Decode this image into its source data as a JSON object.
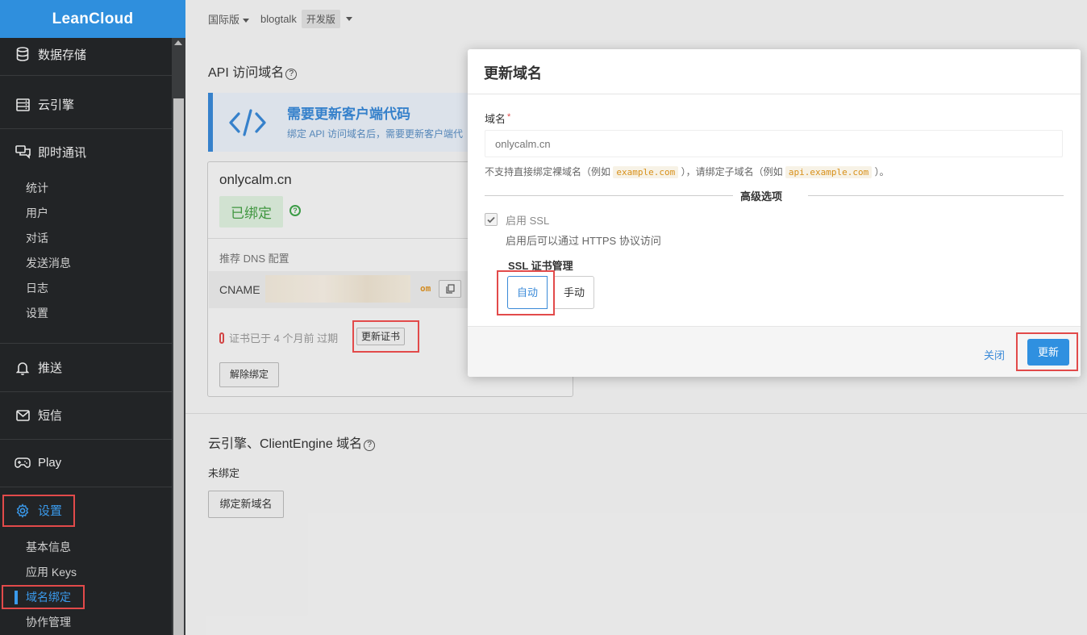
{
  "app": {
    "logo": "LeanCloud"
  },
  "sidebar": {
    "sections": [
      {
        "label": "数据存储",
        "icon": "database-icon"
      },
      {
        "label": "云引擎",
        "icon": "server-icon"
      },
      {
        "label": "即时通讯",
        "icon": "chat-icon",
        "sub": [
          "统计",
          "用户",
          "对话",
          "发送消息",
          "日志",
          "设置"
        ]
      },
      {
        "label": "推送",
        "icon": "bell-icon"
      },
      {
        "label": "短信",
        "icon": "mail-icon"
      },
      {
        "label": "Play",
        "icon": "gamepad-icon"
      },
      {
        "label": "设置",
        "icon": "gear-icon",
        "sub": [
          "基本信息",
          "应用 Keys",
          "域名绑定",
          "协作管理"
        ]
      }
    ]
  },
  "topbar": {
    "region": "国际版",
    "app": "blogtalk",
    "env": "开发版"
  },
  "main": {
    "api_title": "API 访问域名",
    "info_title": "需要更新客户端代码",
    "info_sub": "绑定 API 访问域名后，需要更新客户端代",
    "domain": "onlycalm.cn",
    "bound": "已绑定",
    "dns_label": "推荐 DNS 配置",
    "cname": "CNAME",
    "cname_suffix": "om",
    "cert_text": "证书已于 4 个月前 过期",
    "renew_cert": "更新证书",
    "unbind": "解除绑定",
    "engine_title": "云引擎、ClientEngine 域名",
    "engine_status": "未绑定",
    "bind_new": "绑定新域名"
  },
  "modal": {
    "title": "更新域名",
    "field_label": "域名",
    "required_mark": "*",
    "placeholder": "onlycalm.cn",
    "hint_a": "不支持直接绑定裸域名（例如",
    "hint_code1": "example.com",
    "hint_b": "），请绑定子域名（例如",
    "hint_code2": "api.example.com",
    "hint_c": "）。",
    "advanced": "高级选项",
    "ssl_label": "启用 SSL",
    "ssl_hint": "启用后可以通过 HTTPS 协议访问",
    "cert_mgmt": "SSL 证书管理",
    "auto": "自动",
    "manual": "手动",
    "close": "关闭",
    "update": "更新"
  }
}
